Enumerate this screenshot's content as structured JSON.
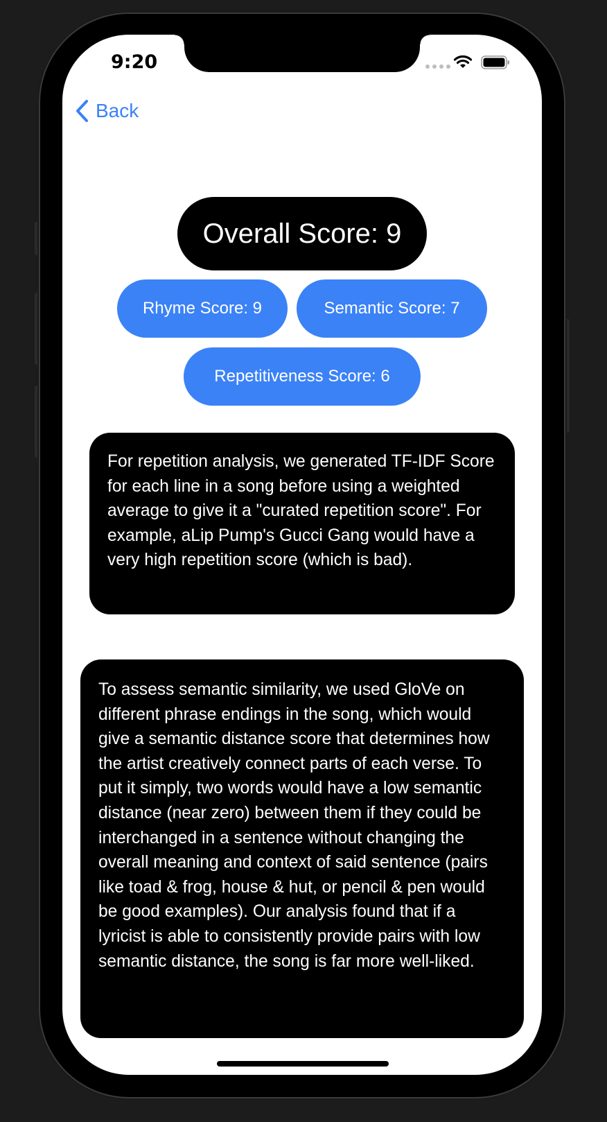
{
  "status_bar": {
    "time": "9:20",
    "icons": [
      "signal-dots-icon",
      "wifi-icon",
      "battery-icon"
    ]
  },
  "nav": {
    "back_label": "Back",
    "back_icon": "chevron-left-icon"
  },
  "scores": {
    "overall": "Overall Score: 9",
    "rhyme": "Rhyme Score: 9",
    "semantic": "Semantic Score: 7",
    "repetitiveness": "Repetitiveness Score: 6"
  },
  "cards": {
    "repetition_text": "For repetition analysis, we generated TF-IDF Score for each line in a song before using a weighted average to give it a \"curated repetition score\". For example, aLip Pump's Gucci Gang would have a very high repetition score (which is bad).",
    "semantic_text": "To assess semantic similarity, we used GloVe on different phrase endings in the song, which would give a semantic distance score that determines how the artist creatively connect parts of each verse. To put it simply, two words would have a low semantic distance (near zero) between them if they could be interchanged in a sentence without changing the overall meaning and context of said sentence (pairs like toad & frog, house & hut, or pencil & pen would be good examples). Our analysis found that if a lyricist is able to consistently provide pairs with low semantic distance, the song is far more well-liked."
  },
  "colors": {
    "accent": "#3b82f6",
    "card_bg": "#000000",
    "screen_bg": "#ffffff"
  }
}
